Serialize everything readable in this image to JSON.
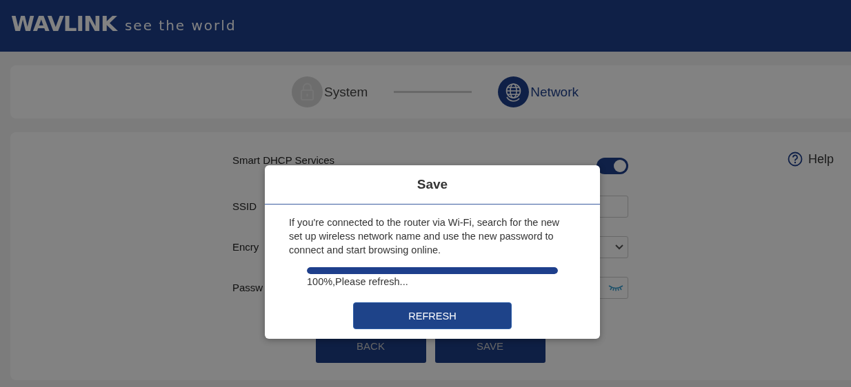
{
  "header": {
    "logo": "WAVLINK",
    "tagline": "see the world"
  },
  "steps": [
    {
      "label": "System",
      "selected": false
    },
    {
      "label": "Network",
      "selected": true
    }
  ],
  "help": "Help",
  "form": {
    "rows": [
      {
        "kind": "toggle",
        "label": "Smart DHCP Services",
        "on": true
      },
      {
        "kind": "text",
        "label": "SSID"
      },
      {
        "kind": "select",
        "label": "Encry"
      },
      {
        "kind": "password",
        "label": "Passw"
      }
    ],
    "buttons": [
      "BACK",
      "SAVE"
    ]
  },
  "dialog": {
    "title": "Save",
    "message": "If you're connected to the router via Wi-Fi, search for the new set up wireless network name and use the new password to connect and start browsing online.",
    "progress": {
      "level": 1,
      "text": "100%,Please refresh..."
    },
    "button": "REFRESH"
  }
}
